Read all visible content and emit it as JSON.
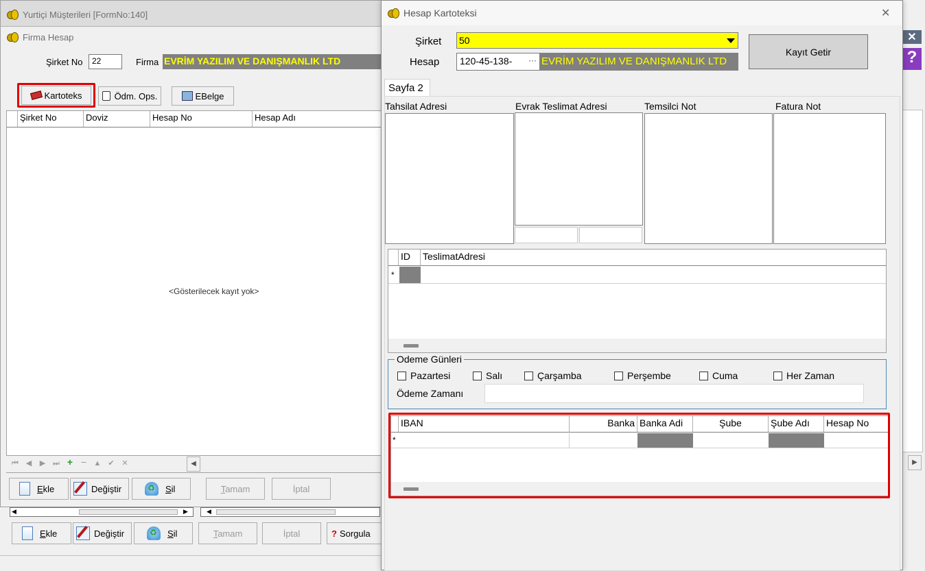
{
  "back_window": {
    "title": "Yurtiçi Müşterileri [FormNo:140]"
  },
  "firma_window": {
    "title": "Firma Hesap",
    "sirket_no_label": "Şirket No",
    "sirket_no_value": "22",
    "firma_label": "Firma",
    "firma_value": "EVRİM YAZILIM VE DANIŞMANLIK LTD",
    "toolbar": {
      "kartoteks": "Kartoteks",
      "odm_ops": "Ödm. Ops.",
      "ebelge": "EBelge"
    },
    "grid": {
      "columns": [
        "Şirket No",
        "Doviz",
        "Hesap No",
        "Hesap Adı"
      ],
      "empty_text": "<Gösterilecek kayıt yok>"
    },
    "buttons": {
      "ekle": "Ekle",
      "degistir": "Değiştir",
      "sil": "Sil",
      "tamam": "Tamam",
      "iptal": "İptal"
    }
  },
  "bottom_buttons": {
    "ekle": "Ekle",
    "degistir": "Değiştir",
    "sil": "Sil",
    "tamam": "Tamam",
    "iptal": "İptal",
    "sorgula": "Sorgula"
  },
  "hesap_window": {
    "title": "Hesap Kartoteksi",
    "close": "✕",
    "sirket_label": "Şirket",
    "sirket_value": "50",
    "hesap_label": "Hesap",
    "hesap_value": "120-45-138-",
    "hesap_ellipsis": "···",
    "hesap_name": "EVRİM YAZILIM VE DANIŞMANLIK LTD",
    "kayit_getir": "Kayıt Getir",
    "tab": "Sayfa 2",
    "memo_labels": {
      "tahsilat": "Tahsilat Adresi",
      "evrak": "Evrak Teslimat Adresi",
      "temsilci": "Temsilci Not",
      "fatura": "Fatura Not"
    },
    "teslimat_grid": {
      "columns": [
        "ID",
        "TeslimatAdresi"
      ],
      "new_row": "*"
    },
    "odeme_gunleri": {
      "legend": "Odeme Günleri",
      "days": [
        "Pazartesi",
        "Salı",
        "Çarşamba",
        "Perşembe",
        "Cuma",
        "Her Zaman"
      ],
      "zaman_label": "Ödeme Zamanı"
    },
    "iban_grid": {
      "columns": [
        "IBAN",
        "Banka",
        "Banka Adi",
        "Şube",
        "Şube Adı",
        "Hesap No"
      ],
      "new_row": "*"
    }
  },
  "colors": {
    "highlight": "#e00000",
    "yellow_field": "#ffff00",
    "gray_field": "#808080"
  }
}
